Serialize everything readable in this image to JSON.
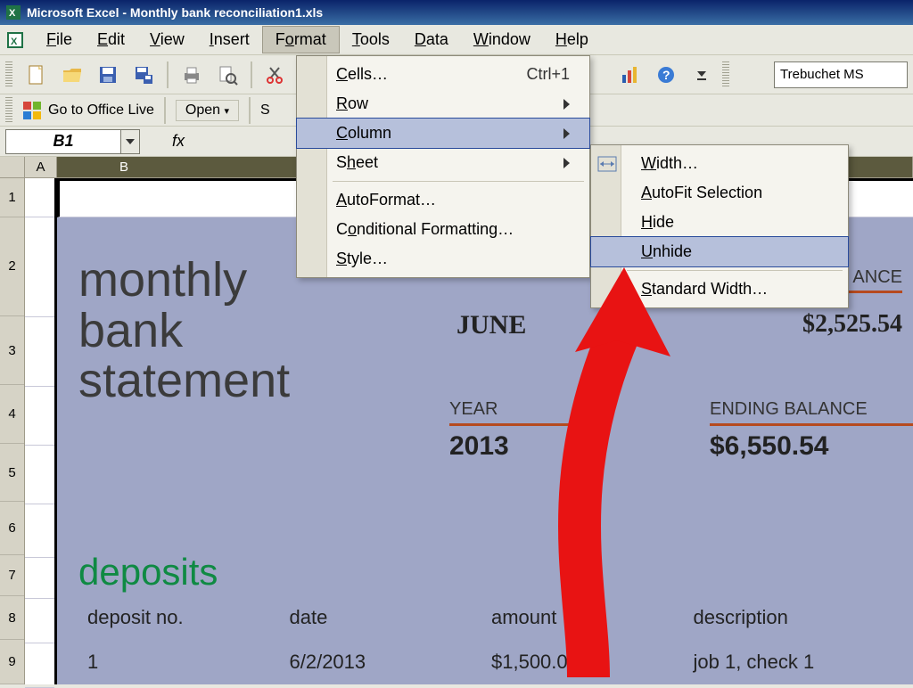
{
  "window": {
    "title": "Microsoft Excel - Monthly bank reconciliation1.xls"
  },
  "menubar": {
    "file": "File",
    "edit": "Edit",
    "view": "View",
    "insert": "Insert",
    "format": "Format",
    "tools": "Tools",
    "data": "Data",
    "window": "Window",
    "help": "Help"
  },
  "toolbar": {
    "font_name": "Trebuchet MS"
  },
  "officelive": {
    "go": "Go to Office Live",
    "open": "Open",
    "extra": "S"
  },
  "formula_bar": {
    "name_box": "B1",
    "fx_label": "fx"
  },
  "columns": {
    "A": "A",
    "B": "B"
  },
  "rows": [
    "1",
    "2",
    "3",
    "4",
    "5",
    "6",
    "7",
    "8",
    "9"
  ],
  "format_menu": {
    "cells": "Cells…",
    "cells_shortcut": "Ctrl+1",
    "row": "Row",
    "column": "Column",
    "sheet": "Sheet",
    "autoformat": "AutoFormat…",
    "conditional": "Conditional Formatting…",
    "style": "Style…"
  },
  "column_submenu": {
    "width": "Width…",
    "autofit": "AutoFit Selection",
    "hide": "Hide",
    "unhide": "Unhide",
    "standard": "Standard Width…"
  },
  "sheet_content": {
    "big_title_l1": "monthly",
    "big_title_l2": "bank",
    "big_title_l3": "statement",
    "june_partial": "JUNE",
    "partial_balance_label": "ANCE",
    "partial_balance_value": "$2,525.54",
    "year_label": "YEAR",
    "year_value": "2013",
    "ending_label": "ENDING BALANCE",
    "ending_value": "$6,550.54",
    "deposits_label": "deposits",
    "headers": {
      "no": "deposit no.",
      "date": "date",
      "amount": "amount",
      "desc": "description"
    },
    "row1": {
      "no": "1",
      "date": "6/2/2013",
      "amount": "$1,500.00",
      "desc": "job 1, check 1"
    }
  }
}
